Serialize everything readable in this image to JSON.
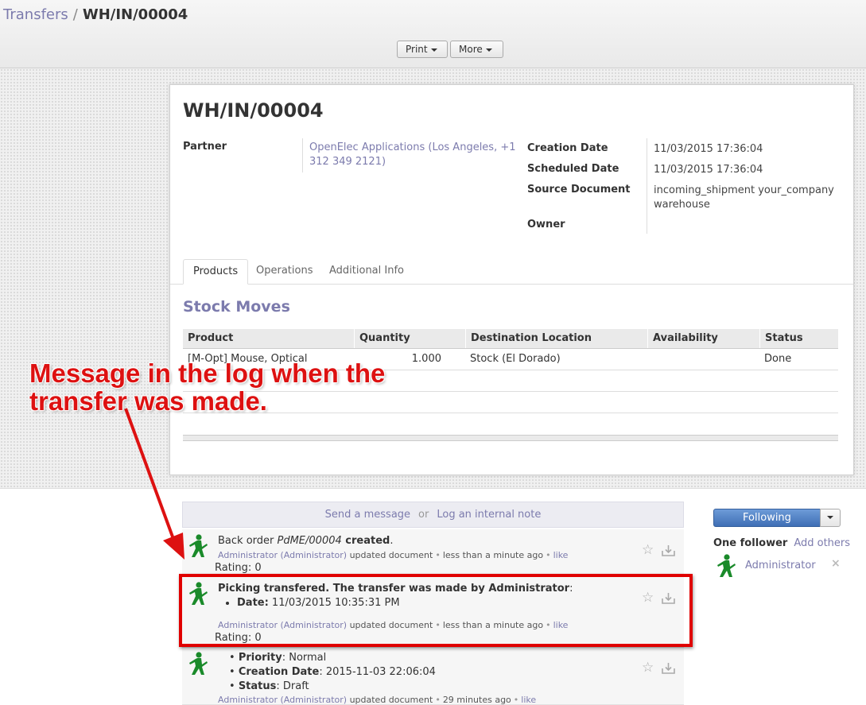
{
  "breadcrumb": {
    "parent": "Transfers",
    "separator": "/",
    "current": "WH/IN/00004"
  },
  "toolbar": {
    "print_label": "Print",
    "more_label": "More"
  },
  "record": {
    "title": "WH/IN/00004",
    "partner_label": "Partner",
    "partner_value_line1": "OpenElec Applications (Los Angeles, +1",
    "partner_value_line2": "312 349 2121)",
    "creation_date_label": "Creation Date",
    "creation_date_value": "11/03/2015 17:36:04",
    "scheduled_date_label": "Scheduled Date",
    "scheduled_date_value": "11/03/2015 17:36:04",
    "source_document_label": "Source Document",
    "source_document_line1": "incoming_shipment your_company",
    "source_document_line2": "warehouse",
    "owner_label": "Owner"
  },
  "tabs": [
    {
      "label": "Products"
    },
    {
      "label": "Operations"
    },
    {
      "label": "Additional Info"
    }
  ],
  "stock_moves": {
    "title": "Stock Moves",
    "columns": [
      "Product",
      "Quantity",
      "Destination Location",
      "Availability",
      "Status"
    ],
    "rows": [
      {
        "product": "[M-Opt] Mouse, Optical",
        "quantity": "1.000",
        "destination": "Stock (El Dorado)",
        "availability": "",
        "status": "Done"
      }
    ]
  },
  "composer": {
    "send_message": "Send a message",
    "or": "or",
    "log_note": "Log an internal note"
  },
  "messages": [
    {
      "text_prefix": "Back order ",
      "text_italic": "PdME/00004",
      "text_bold": " created",
      "text_suffix": ".",
      "author": "Administrator (Administrator)",
      "action": "updated document",
      "time": "less than a minute ago",
      "like": "like",
      "rating": "Rating: 0"
    },
    {
      "text_bold": "Picking transfered. The transfer was made by Administrator",
      "text_suffix": ":",
      "bullet_label": "Date:",
      "bullet_value": " 11/03/2015 10:35:31 PM",
      "author": "Administrator (Administrator)",
      "action": "updated document",
      "time": "less than a minute ago",
      "like": "like",
      "rating": "Rating: 0"
    },
    {
      "bullets": [
        {
          "label": "Priority",
          "value": ": Normal"
        },
        {
          "label": "Creation Date",
          "value": ": 2015-11-03 22:06:04"
        },
        {
          "label": "Status",
          "value": ": Draft"
        }
      ],
      "author": "Administrator (Administrator)",
      "action": "updated document",
      "time": "29 minutes ago",
      "like": "like"
    }
  ],
  "sidebar": {
    "following_label": "Following",
    "followers_count": "One follower",
    "add_others": "Add others",
    "follower_name": "Administrator",
    "remove": "×"
  },
  "annotation": {
    "line1": "Message in the log when the",
    "line2": "transfer was made."
  },
  "colors": {
    "accent": "#7c7bad",
    "annotation_red": "#e00000",
    "avatar_green": "#1a8a2a",
    "follow_blue": "#4a7bc0"
  },
  "icons": {
    "avatar": "green-man-icon",
    "star": "star-icon",
    "download": "download-icon",
    "caret": "caret-down-icon"
  }
}
